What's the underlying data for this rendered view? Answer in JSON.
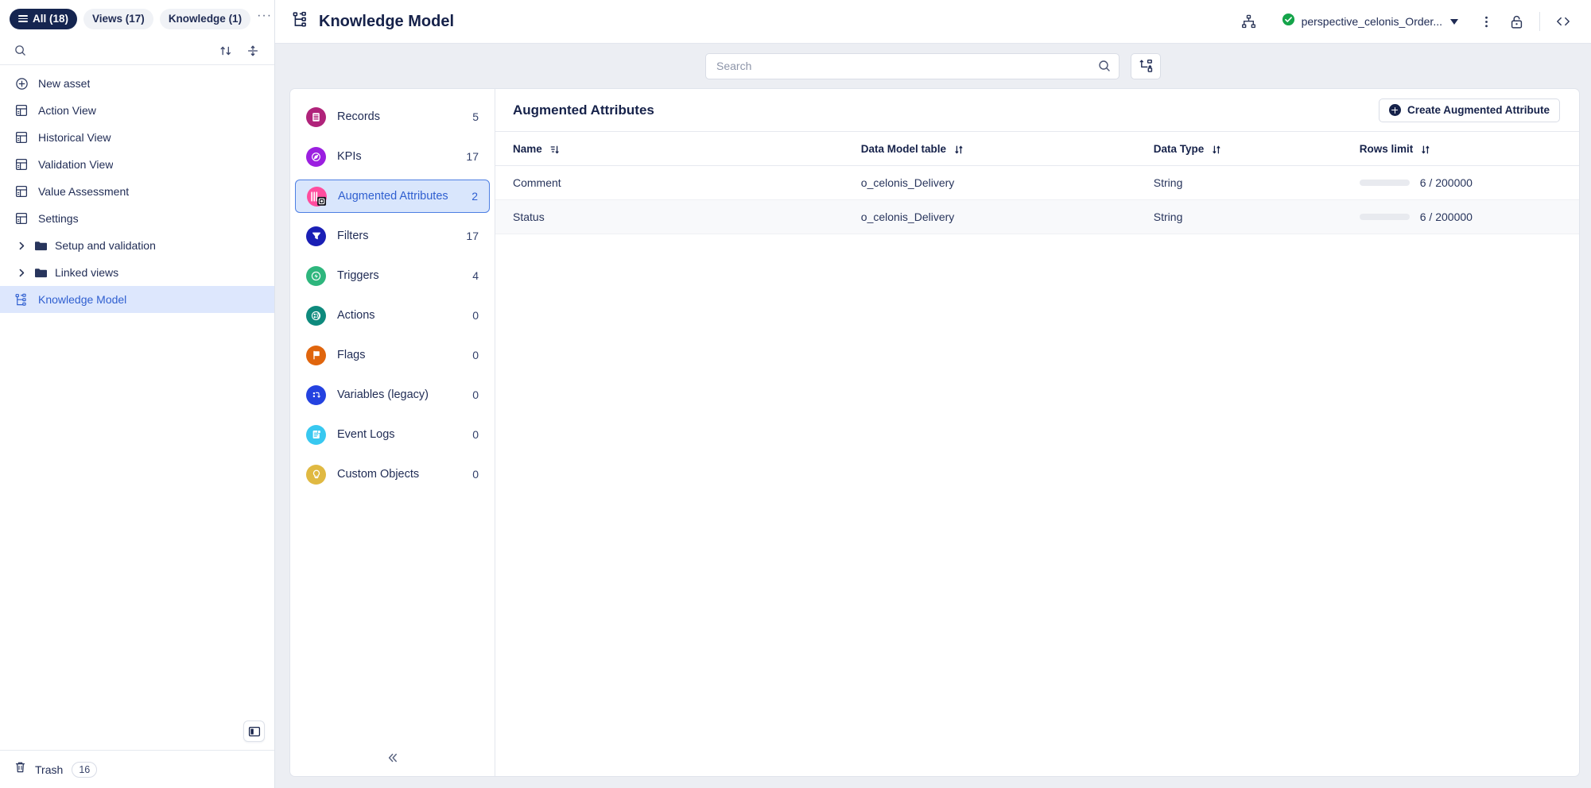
{
  "sidebar": {
    "tabs": [
      {
        "label": "All (18)",
        "active": true,
        "name": "tab-all"
      },
      {
        "label": "Views (17)",
        "active": false,
        "name": "tab-views"
      },
      {
        "label": "Knowledge (1)",
        "active": false,
        "name": "tab-knowledge"
      }
    ],
    "more_label": "···",
    "search": {
      "placeholder": "",
      "value": ""
    },
    "items": [
      {
        "label": "New asset",
        "icon": "plus-circle-icon"
      },
      {
        "label": "Action View",
        "icon": "view-grid-icon"
      },
      {
        "label": "Historical View",
        "icon": "view-grid-icon"
      },
      {
        "label": "Validation View",
        "icon": "view-grid-icon"
      },
      {
        "label": "Value Assessment",
        "icon": "view-grid-icon"
      },
      {
        "label": "Settings",
        "icon": "view-grid-icon"
      },
      {
        "label": "Setup and validation",
        "icon": "folder-icon",
        "nested": true
      },
      {
        "label": "Linked views",
        "icon": "folder-icon",
        "nested": true
      },
      {
        "label": "Knowledge Model",
        "icon": "knowledge-model-icon",
        "selected": true
      }
    ],
    "trash": {
      "label": "Trash",
      "count": "16"
    }
  },
  "header": {
    "title": "Knowledge Model",
    "data_model": "perspective_celonis_Order...",
    "status": "connected"
  },
  "search": {
    "placeholder": "Search",
    "value": ""
  },
  "categories": [
    {
      "label": "Records",
      "count": "5",
      "color": "#b0237a",
      "icon": "records-icon"
    },
    {
      "label": "KPIs",
      "count": "17",
      "color": "#9b1fe0",
      "icon": "kpi-compass-icon"
    },
    {
      "label": "Augmented Attributes",
      "count": "2",
      "color": "#ff4d9e",
      "icon": "augmented-attributes-icon",
      "selected": true
    },
    {
      "label": "Filters",
      "count": "17",
      "color": "#1a1fb5",
      "icon": "filter-funnel-icon"
    },
    {
      "label": "Triggers",
      "count": "4",
      "color": "#2eb67d",
      "icon": "trigger-icon"
    },
    {
      "label": "Actions",
      "count": "0",
      "color": "#0e8a7d",
      "icon": "actions-icon"
    },
    {
      "label": "Flags",
      "count": "0",
      "color": "#e0650d",
      "icon": "flag-icon"
    },
    {
      "label": "Variables (legacy)",
      "count": "0",
      "color": "#2442e0",
      "icon": "variables-icon"
    },
    {
      "label": "Event Logs",
      "count": "0",
      "color": "#38c8f0",
      "icon": "event-logs-icon"
    },
    {
      "label": "Custom Objects",
      "count": "0",
      "color": "#e0b942",
      "icon": "lightbulb-icon"
    }
  ],
  "detail": {
    "title": "Augmented Attributes",
    "create_button": "Create Augmented Attribute",
    "columns": [
      "Name",
      "Data Model table",
      "Data Type",
      "Rows limit"
    ],
    "rows": [
      {
        "name": "Comment",
        "table": "o_celonis_Delivery",
        "type": "String",
        "rows": "6 / 200000"
      },
      {
        "name": "Status",
        "table": "o_celonis_Delivery",
        "type": "String",
        "rows": "6 / 200000"
      }
    ]
  }
}
